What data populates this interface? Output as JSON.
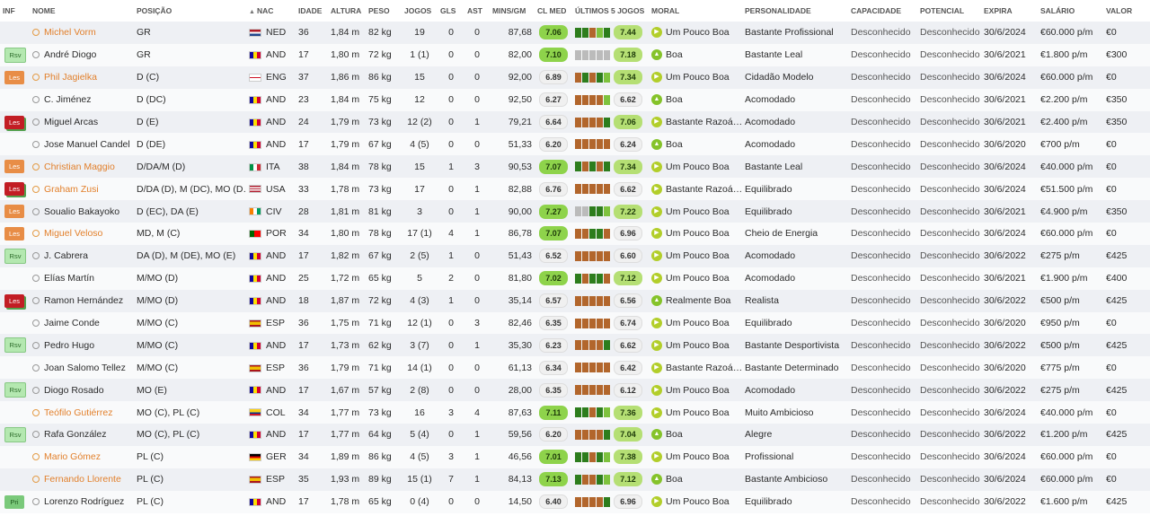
{
  "columns": {
    "inf": "INF",
    "nome": "NOME",
    "posicao": "POSIÇÃO",
    "nac": "NAC",
    "idade": "IDADE",
    "altura": "ALTURA",
    "peso": "PESO",
    "jogos": "JOGOS",
    "gls": "GLS",
    "ast": "AST",
    "mins": "MINS/GM",
    "clmed": "CL MED",
    "ultimos": "ÚLTIMOS 5 JOGOS",
    "moral": "MORAL",
    "personalidade": "PERSONALIDADE",
    "capacidade": "CAPACIDADE",
    "potencial": "POTENCIAL",
    "expira": "EXPIRA",
    "salario": "SALÁRIO",
    "valor": "VALOR"
  },
  "sort_icon": "sort-up-arrow",
  "colors": {
    "highlight_name": "#e2802c",
    "rating_good": "#8ed34b",
    "form_dark_green": "#2d7d1d",
    "form_light_green": "#7ec23e",
    "form_brown": "#b2662c",
    "badge_injured": "#c21d24",
    "badge_les_orange": "#e88d46",
    "badge_rsv": "#b4e8b0"
  },
  "players": [
    {
      "inf": "",
      "badge": "",
      "name": "Michel Vorm",
      "hl": true,
      "pos": "GR",
      "nat": "NED",
      "age": "36",
      "height": "1,84 m",
      "weight": "82 kg",
      "apps": "19",
      "gls": "0",
      "ast": "0",
      "mins": "87,68",
      "avg": "7.06",
      "avg_hl": true,
      "form": [
        "dg",
        "dg",
        "br",
        "lg",
        "dg"
      ],
      "form_avg": "7.44",
      "form_hl": true,
      "morale": "Um Pouco Boa",
      "pers": "Bastante Profissional",
      "cap": "Desconhecido",
      "pot": "Desconhecido",
      "exp": "30/6/2024",
      "sal": "€60.000 p/m",
      "val": "€0"
    },
    {
      "inf": "Rsv",
      "badge": "rsv",
      "name": "André Diogo",
      "hl": false,
      "pos": "GR",
      "nat": "AND",
      "age": "17",
      "height": "1,80 m",
      "weight": "72 kg",
      "apps": "1 (1)",
      "gls": "0",
      "ast": "0",
      "mins": "82,00",
      "avg": "7.10",
      "avg_hl": true,
      "form": [
        "gy",
        "gy",
        "gy",
        "gy",
        "gy"
      ],
      "form_avg": "7.18",
      "form_hl": true,
      "morale": "Boa",
      "pers": "Bastante Leal",
      "cap": "Desconhecido",
      "pot": "Desconhecido",
      "exp": "30/6/2021",
      "sal": "€1.800 p/m",
      "val": "€300"
    },
    {
      "inf": "Les",
      "badge": "les-o",
      "name": "Phil Jagielka",
      "hl": true,
      "pos": "D (C)",
      "nat": "ENG",
      "age": "37",
      "height": "1,86 m",
      "weight": "86 kg",
      "apps": "15",
      "gls": "0",
      "ast": "0",
      "mins": "92,00",
      "avg": "6.89",
      "avg_hl": false,
      "form": [
        "br",
        "dg",
        "br",
        "dg",
        "lg"
      ],
      "form_avg": "7.34",
      "form_hl": true,
      "morale": "Um Pouco Boa",
      "pers": "Cidadão Modelo",
      "cap": "Desconhecido",
      "pot": "Desconhecido",
      "exp": "30/6/2024",
      "sal": "€60.000 p/m",
      "val": "€0"
    },
    {
      "inf": "",
      "badge": "",
      "name": "C. Jiménez",
      "hl": false,
      "pos": "D (DC)",
      "nat": "AND",
      "age": "23",
      "height": "1,84 m",
      "weight": "75 kg",
      "apps": "12",
      "gls": "0",
      "ast": "0",
      "mins": "92,50",
      "avg": "6.27",
      "avg_hl": false,
      "form": [
        "br",
        "br",
        "br",
        "br",
        "lg"
      ],
      "form_avg": "6.62",
      "form_hl": false,
      "morale": "Boa",
      "pers": "Acomodado",
      "cap": "Desconhecido",
      "pot": "Desconhecido",
      "exp": "30/6/2021",
      "sal": "€2.200 p/m",
      "val": "€350"
    },
    {
      "inf": "Les",
      "badge": "les-r",
      "name": "Miguel Arcas",
      "hl": false,
      "pos": "D (E)",
      "nat": "AND",
      "age": "24",
      "height": "1,79 m",
      "weight": "73 kg",
      "apps": "12 (2)",
      "gls": "0",
      "ast": "1",
      "mins": "79,21",
      "avg": "6.64",
      "avg_hl": false,
      "form": [
        "br",
        "br",
        "br",
        "br",
        "dg"
      ],
      "form_avg": "7.06",
      "form_hl": true,
      "morale": "Bastante Razoá…",
      "pers": "Acomodado",
      "cap": "Desconhecido",
      "pot": "Desconhecido",
      "exp": "30/6/2021",
      "sal": "€2.400 p/m",
      "val": "€350"
    },
    {
      "inf": "",
      "badge": "",
      "name": "Jose Manuel Candel",
      "hl": false,
      "pos": "D (DE)",
      "nat": "AND",
      "age": "17",
      "height": "1,79 m",
      "weight": "67 kg",
      "apps": "4 (5)",
      "gls": "0",
      "ast": "0",
      "mins": "51,33",
      "avg": "6.20",
      "avg_hl": false,
      "form": [
        "br",
        "br",
        "br",
        "br",
        "br"
      ],
      "form_avg": "6.24",
      "form_hl": false,
      "morale": "Boa",
      "pers": "Acomodado",
      "cap": "Desconhecido",
      "pot": "Desconhecido",
      "exp": "30/6/2020",
      "sal": "€700 p/m",
      "val": "€0"
    },
    {
      "inf": "Les",
      "badge": "les-o",
      "name": "Christian Maggio",
      "hl": true,
      "pos": "D/DA/M (D)",
      "nat": "ITA",
      "age": "38",
      "height": "1,84 m",
      "weight": "78 kg",
      "apps": "15",
      "gls": "1",
      "ast": "3",
      "mins": "90,53",
      "avg": "7.07",
      "avg_hl": true,
      "form": [
        "dg",
        "br",
        "dg",
        "br",
        "dg"
      ],
      "form_avg": "7.34",
      "form_hl": true,
      "morale": "Um Pouco Boa",
      "pers": "Bastante Leal",
      "cap": "Desconhecido",
      "pot": "Desconhecido",
      "exp": "30/6/2024",
      "sal": "€40.000 p/m",
      "val": "€0"
    },
    {
      "inf": "Les",
      "badge": "les-r",
      "name": "Graham Zusi",
      "hl": true,
      "pos": "D/DA (D), M (DC), MO (D…",
      "nat": "USA",
      "age": "33",
      "height": "1,78 m",
      "weight": "73 kg",
      "apps": "17",
      "gls": "0",
      "ast": "1",
      "mins": "82,88",
      "avg": "6.76",
      "avg_hl": false,
      "form": [
        "br",
        "br",
        "br",
        "br",
        "br"
      ],
      "form_avg": "6.62",
      "form_hl": false,
      "morale": "Bastante Razoá…",
      "pers": "Equilibrado",
      "cap": "Desconhecido",
      "pot": "Desconhecido",
      "exp": "30/6/2024",
      "sal": "€51.500 p/m",
      "val": "€0"
    },
    {
      "inf": "Les",
      "badge": "les-o",
      "name": "Soualio Bakayoko",
      "hl": false,
      "pos": "D (EC), DA (E)",
      "nat": "CIV",
      "age": "28",
      "height": "1,81 m",
      "weight": "81 kg",
      "apps": "3",
      "gls": "0",
      "ast": "1",
      "mins": "90,00",
      "avg": "7.27",
      "avg_hl": true,
      "form": [
        "gy",
        "gy",
        "dg",
        "dg",
        "lg"
      ],
      "form_avg": "7.22",
      "form_hl": true,
      "morale": "Um Pouco Boa",
      "pers": "Equilibrado",
      "cap": "Desconhecido",
      "pot": "Desconhecido",
      "exp": "30/6/2021",
      "sal": "€4.900 p/m",
      "val": "€350"
    },
    {
      "inf": "Les",
      "badge": "les-o",
      "name": "Miguel Veloso",
      "hl": true,
      "pos": "MD, M (C)",
      "nat": "POR",
      "age": "34",
      "height": "1,80 m",
      "weight": "78 kg",
      "apps": "17 (1)",
      "gls": "4",
      "ast": "1",
      "mins": "86,78",
      "avg": "7.07",
      "avg_hl": true,
      "form": [
        "br",
        "br",
        "dg",
        "dg",
        "br"
      ],
      "form_avg": "6.96",
      "form_hl": false,
      "morale": "Um Pouco Boa",
      "pers": "Cheio de Energia",
      "cap": "Desconhecido",
      "pot": "Desconhecido",
      "exp": "30/6/2024",
      "sal": "€60.000 p/m",
      "val": "€0"
    },
    {
      "inf": "Rsv",
      "badge": "rsv",
      "name": "J. Cabrera",
      "hl": false,
      "pos": "DA (D), M (DE), MO (E)",
      "nat": "AND",
      "age": "17",
      "height": "1,82 m",
      "weight": "67 kg",
      "apps": "2 (5)",
      "gls": "1",
      "ast": "0",
      "mins": "51,43",
      "avg": "6.52",
      "avg_hl": false,
      "form": [
        "br",
        "br",
        "br",
        "br",
        "br"
      ],
      "form_avg": "6.60",
      "form_hl": false,
      "morale": "Um Pouco Boa",
      "pers": "Acomodado",
      "cap": "Desconhecido",
      "pot": "Desconhecido",
      "exp": "30/6/2022",
      "sal": "€275 p/m",
      "val": "€425"
    },
    {
      "inf": "",
      "badge": "",
      "name": "Elías Martín",
      "hl": false,
      "pos": "M/MO (D)",
      "nat": "AND",
      "age": "25",
      "height": "1,72 m",
      "weight": "65 kg",
      "apps": "5",
      "gls": "2",
      "ast": "0",
      "mins": "81,80",
      "avg": "7.02",
      "avg_hl": true,
      "form": [
        "dg",
        "br",
        "dg",
        "dg",
        "br"
      ],
      "form_avg": "7.12",
      "form_hl": true,
      "morale": "Um Pouco Boa",
      "pers": "Acomodado",
      "cap": "Desconhecido",
      "pot": "Desconhecido",
      "exp": "30/6/2021",
      "sal": "€1.900 p/m",
      "val": "€400"
    },
    {
      "inf": "Les",
      "badge": "les-r",
      "name": "Ramon Hernández",
      "hl": false,
      "pos": "M/MO (D)",
      "nat": "AND",
      "age": "18",
      "height": "1,87 m",
      "weight": "72 kg",
      "apps": "4 (3)",
      "gls": "1",
      "ast": "0",
      "mins": "35,14",
      "avg": "6.57",
      "avg_hl": false,
      "form": [
        "br",
        "br",
        "br",
        "br",
        "br"
      ],
      "form_avg": "6.56",
      "form_hl": false,
      "morale": "Realmente Boa",
      "pers": "Realista",
      "cap": "Desconhecido",
      "pot": "Desconhecido",
      "exp": "30/6/2022",
      "sal": "€500 p/m",
      "val": "€425"
    },
    {
      "inf": "",
      "badge": "",
      "name": "Jaime Conde",
      "hl": false,
      "pos": "M/MO (C)",
      "nat": "ESP",
      "age": "36",
      "height": "1,75 m",
      "weight": "71 kg",
      "apps": "12 (1)",
      "gls": "0",
      "ast": "3",
      "mins": "82,46",
      "avg": "6.35",
      "avg_hl": false,
      "form": [
        "br",
        "br",
        "br",
        "br",
        "br"
      ],
      "form_avg": "6.74",
      "form_hl": false,
      "morale": "Um Pouco Boa",
      "pers": "Equilibrado",
      "cap": "Desconhecido",
      "pot": "Desconhecido",
      "exp": "30/6/2020",
      "sal": "€950 p/m",
      "val": "€0"
    },
    {
      "inf": "Rsv",
      "badge": "rsv",
      "name": "Pedro Hugo",
      "hl": false,
      "pos": "M/MO (C)",
      "nat": "AND",
      "age": "17",
      "height": "1,73 m",
      "weight": "62 kg",
      "apps": "3 (7)",
      "gls": "0",
      "ast": "1",
      "mins": "35,30",
      "avg": "6.23",
      "avg_hl": false,
      "form": [
        "br",
        "br",
        "br",
        "br",
        "dg"
      ],
      "form_avg": "6.62",
      "form_hl": false,
      "morale": "Um Pouco Boa",
      "pers": "Bastante Desportivista",
      "cap": "Desconhecido",
      "pot": "Desconhecido",
      "exp": "30/6/2022",
      "sal": "€500 p/m",
      "val": "€425"
    },
    {
      "inf": "",
      "badge": "",
      "name": "Joan Salomo Tellez",
      "hl": false,
      "pos": "M/MO (C)",
      "nat": "ESP",
      "age": "36",
      "height": "1,79 m",
      "weight": "71 kg",
      "apps": "14 (1)",
      "gls": "0",
      "ast": "0",
      "mins": "61,13",
      "avg": "6.34",
      "avg_hl": false,
      "form": [
        "br",
        "br",
        "br",
        "br",
        "br"
      ],
      "form_avg": "6.42",
      "form_hl": false,
      "morale": "Bastante Razoá…",
      "pers": "Bastante Determinado",
      "cap": "Desconhecido",
      "pot": "Desconhecido",
      "exp": "30/6/2020",
      "sal": "€775 p/m",
      "val": "€0"
    },
    {
      "inf": "Rsv",
      "badge": "rsv",
      "name": "Diogo Rosado",
      "hl": false,
      "pos": "MO (E)",
      "nat": "AND",
      "age": "17",
      "height": "1,67 m",
      "weight": "57 kg",
      "apps": "2 (8)",
      "gls": "0",
      "ast": "0",
      "mins": "28,00",
      "avg": "6.35",
      "avg_hl": false,
      "form": [
        "br",
        "br",
        "br",
        "br",
        "br"
      ],
      "form_avg": "6.12",
      "form_hl": false,
      "morale": "Um Pouco Boa",
      "pers": "Acomodado",
      "cap": "Desconhecido",
      "pot": "Desconhecido",
      "exp": "30/6/2022",
      "sal": "€275 p/m",
      "val": "€425"
    },
    {
      "inf": "",
      "badge": "",
      "name": "Teófilo Gutiérrez",
      "hl": true,
      "pos": "MO (C), PL (C)",
      "nat": "COL",
      "age": "34",
      "height": "1,77 m",
      "weight": "73 kg",
      "apps": "16",
      "gls": "3",
      "ast": "4",
      "mins": "87,63",
      "avg": "7.11",
      "avg_hl": true,
      "form": [
        "dg",
        "dg",
        "br",
        "dg",
        "lg"
      ],
      "form_avg": "7.36",
      "form_hl": true,
      "morale": "Um Pouco Boa",
      "pers": "Muito Ambicioso",
      "cap": "Desconhecido",
      "pot": "Desconhecido",
      "exp": "30/6/2024",
      "sal": "€40.000 p/m",
      "val": "€0"
    },
    {
      "inf": "Rsv",
      "badge": "rsv",
      "name": "Rafa González",
      "hl": false,
      "pos": "MO (C), PL (C)",
      "nat": "AND",
      "age": "17",
      "height": "1,77 m",
      "weight": "64 kg",
      "apps": "5 (4)",
      "gls": "0",
      "ast": "1",
      "mins": "59,56",
      "avg": "6.20",
      "avg_hl": false,
      "form": [
        "br",
        "br",
        "br",
        "br",
        "dg"
      ],
      "form_avg": "7.04",
      "form_hl": true,
      "morale": "Boa",
      "pers": "Alegre",
      "cap": "Desconhecido",
      "pot": "Desconhecido",
      "exp": "30/6/2022",
      "sal": "€1.200 p/m",
      "val": "€425"
    },
    {
      "inf": "",
      "badge": "",
      "name": "Mario Gómez",
      "hl": true,
      "pos": "PL (C)",
      "nat": "GER",
      "age": "34",
      "height": "1,89 m",
      "weight": "86 kg",
      "apps": "4 (5)",
      "gls": "3",
      "ast": "1",
      "mins": "46,56",
      "avg": "7.01",
      "avg_hl": true,
      "form": [
        "dg",
        "dg",
        "br",
        "dg",
        "lg"
      ],
      "form_avg": "7.38",
      "form_hl": true,
      "morale": "Um Pouco Boa",
      "pers": "Profissional",
      "cap": "Desconhecido",
      "pot": "Desconhecido",
      "exp": "30/6/2024",
      "sal": "€60.000 p/m",
      "val": "€0"
    },
    {
      "inf": "",
      "badge": "",
      "name": "Fernando Llorente",
      "hl": true,
      "pos": "PL (C)",
      "nat": "ESP",
      "age": "35",
      "height": "1,93 m",
      "weight": "89 kg",
      "apps": "15 (1)",
      "gls": "7",
      "ast": "1",
      "mins": "84,13",
      "avg": "7.13",
      "avg_hl": true,
      "form": [
        "dg",
        "br",
        "br",
        "dg",
        "lg"
      ],
      "form_avg": "7.12",
      "form_hl": true,
      "morale": "Boa",
      "pers": "Bastante Ambicioso",
      "cap": "Desconhecido",
      "pot": "Desconhecido",
      "exp": "30/6/2024",
      "sal": "€60.000 p/m",
      "val": "€0"
    },
    {
      "inf": "Pri",
      "badge": "pri",
      "name": "Lorenzo Rodríguez",
      "hl": false,
      "pos": "PL (C)",
      "nat": "AND",
      "age": "17",
      "height": "1,78 m",
      "weight": "65 kg",
      "apps": "0 (4)",
      "gls": "0",
      "ast": "0",
      "mins": "14,50",
      "avg": "6.40",
      "avg_hl": false,
      "form": [
        "br",
        "br",
        "br",
        "br",
        "dg"
      ],
      "form_avg": "6.96",
      "form_hl": false,
      "morale": "Um Pouco Boa",
      "pers": "Equilibrado",
      "cap": "Desconhecido",
      "pot": "Desconhecido",
      "exp": "30/6/2022",
      "sal": "€1.600 p/m",
      "val": "€425"
    }
  ]
}
